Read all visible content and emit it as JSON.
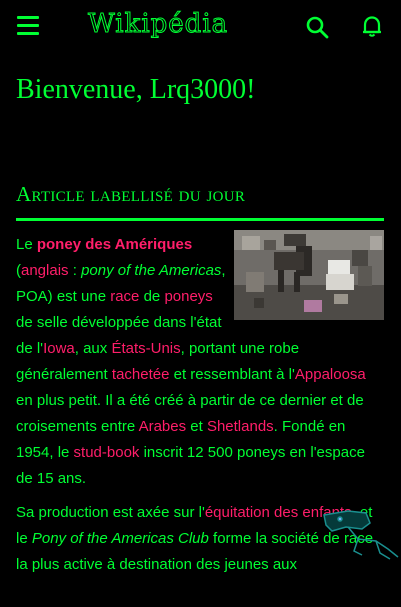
{
  "header": {
    "menu_icon": "hamburger-menu-icon",
    "logo_text": "Wikipédia",
    "search_icon": "search-icon",
    "notifications_icon": "bell-icon"
  },
  "welcome": "Bienvenue, Lrq3000!",
  "featured": {
    "section_title": "Article labellisé du jour",
    "p1": {
      "t1": "Le ",
      "l_title": "poney des Amériques",
      "t2": "",
      "t3": "(",
      "l_anglais": "anglais",
      "t4": " : ",
      "i1": "pony of the Americas",
      "t5": ", POA) est une ",
      "l_race": "race",
      "t6": " de ",
      "l_poneys": "poneys",
      "t7": " de selle développée dans l'état de l'",
      "l_iowa": "Iowa",
      "t8": ", aux ",
      "l_usa": "États-Unis",
      "t9": ", portant une robe généralement ",
      "l_tachetee": "tachetée",
      "t10": " et ressemblant à l'",
      "l_appaloosa": "Appaloosa",
      "t11": " en plus petit. Il a été créé à partir de ce dernier et de croisements entre ",
      "l_arabes": "Arabes",
      "t12": " et ",
      "l_shetlands": "Shetlands",
      "t13": ". Fondé en 1954, le ",
      "l_studbook": "stud-book",
      "t14": " inscrit 12 500 poneys en l'espace de 15 ans."
    },
    "p2": {
      "t1": "Sa production est axée sur l'",
      "l_equitation": "équitation des enfants",
      "t2": ", et le ",
      "i1": "Pony of the Americas Club",
      "t3": " forme la société de race la plus active à destination des jeunes aux"
    }
  }
}
